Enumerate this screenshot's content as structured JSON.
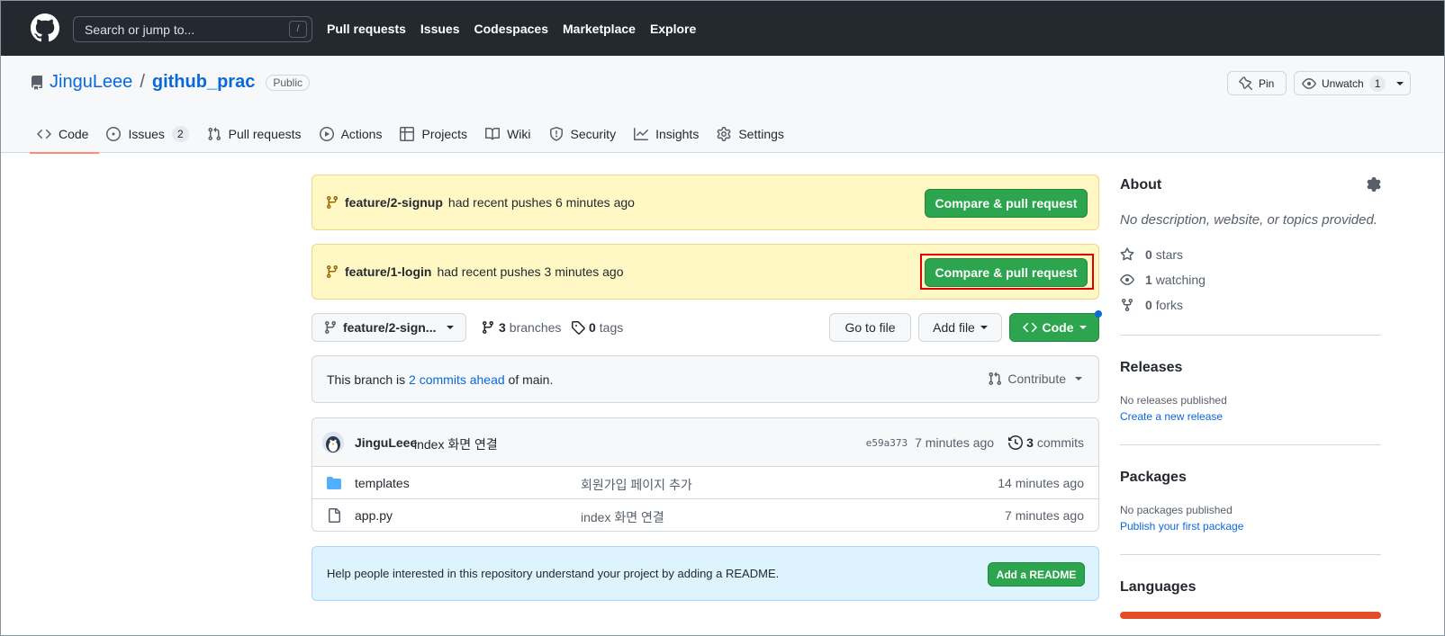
{
  "topbar": {
    "search_placeholder": "Search or jump to...",
    "slash_key": "/",
    "nav": [
      "Pull requests",
      "Issues",
      "Codespaces",
      "Marketplace",
      "Explore"
    ]
  },
  "repo": {
    "owner": "JinguLeee",
    "separator": "/",
    "name": "github_prac",
    "visibility": "Public",
    "pin_label": "Pin",
    "unwatch_label": "Unwatch",
    "watch_count": "1"
  },
  "tabs": [
    {
      "label": "Code",
      "icon": "code-icon"
    },
    {
      "label": "Issues",
      "icon": "issue-icon",
      "count": "2"
    },
    {
      "label": "Pull requests",
      "icon": "pull-request-icon"
    },
    {
      "label": "Actions",
      "icon": "play-icon"
    },
    {
      "label": "Projects",
      "icon": "table-icon"
    },
    {
      "label": "Wiki",
      "icon": "book-icon"
    },
    {
      "label": "Security",
      "icon": "shield-icon"
    },
    {
      "label": "Insights",
      "icon": "graph-icon"
    },
    {
      "label": "Settings",
      "icon": "gear-icon"
    }
  ],
  "banners": [
    {
      "branch": "feature/2-signup",
      "text": "had recent pushes 6 minutes ago",
      "button": "Compare & pull request"
    },
    {
      "branch": "feature/1-login",
      "text": "had recent pushes 3 minutes ago",
      "button": "Compare & pull request"
    }
  ],
  "branchbar": {
    "current_branch": "feature/2-sign...",
    "branches_count": "3",
    "branches_label": "branches",
    "tags_count": "0",
    "tags_label": "tags",
    "goto_file": "Go to file",
    "add_file": "Add file",
    "code": "Code"
  },
  "ahead": {
    "prefix": "This branch is",
    "link": "2 commits ahead",
    "suffix": "of main.",
    "contribute": "Contribute"
  },
  "latest_commit": {
    "author": "JinguLeee",
    "message": "index 화면 연결",
    "sha": "e59a373",
    "age": "7 minutes ago",
    "count": "3",
    "count_label": "commits"
  },
  "files": [
    {
      "type": "folder",
      "name": "templates",
      "message": "회원가입 페이지 추가",
      "age": "14 minutes ago"
    },
    {
      "type": "file",
      "name": "app.py",
      "message": "index 화면 연결",
      "age": "7 minutes ago"
    }
  ],
  "readme": {
    "text": "Help people interested in this repository understand your project by adding a README.",
    "button": "Add a README"
  },
  "sidebar": {
    "about_title": "About",
    "about_desc": "No description, website, or topics provided.",
    "stars": "0",
    "stars_label": "stars",
    "watching": "1",
    "watching_label": "watching",
    "forks": "0",
    "forks_label": "forks",
    "releases_title": "Releases",
    "releases_none": "No releases published",
    "releases_link": "Create a new release",
    "packages_title": "Packages",
    "packages_none": "No packages published",
    "packages_link": "Publish your first package",
    "languages_title": "Languages"
  },
  "colors": {
    "header_bg": "#24292f",
    "primary_green": "#2da44e",
    "banner_yellow": "#fff8c5",
    "link_blue": "#0969da",
    "highlight_red": "#e00000",
    "language_bar": "#e34c26"
  }
}
